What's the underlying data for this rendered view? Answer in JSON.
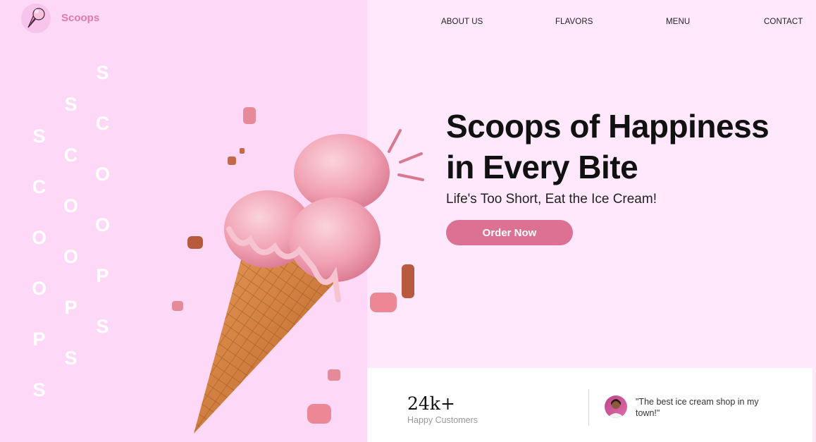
{
  "brand": {
    "name": "Scoops",
    "logo_icon": "ice-cream-cone-icon"
  },
  "nav": {
    "items": [
      "ABOUT US",
      "FLAVORS",
      "MENU",
      "CONTACT"
    ]
  },
  "decor": {
    "vertical_word": "SCOOPS"
  },
  "hero": {
    "title_line1": "Scoops of Happiness",
    "title_line2": "in Every Bite",
    "subtitle": "Life's Too Short, Eat the Ice Cream!",
    "cta_label": "Order Now"
  },
  "stats": {
    "value": "24k+",
    "label": "Happy Customers",
    "testimonial": "\"The best ice cream shop in my town!\""
  },
  "colors": {
    "left_bg": "#fdd8f7",
    "right_bg": "#ffe8fc",
    "accent": "#dd7193",
    "brand_text": "#e07aa8"
  }
}
